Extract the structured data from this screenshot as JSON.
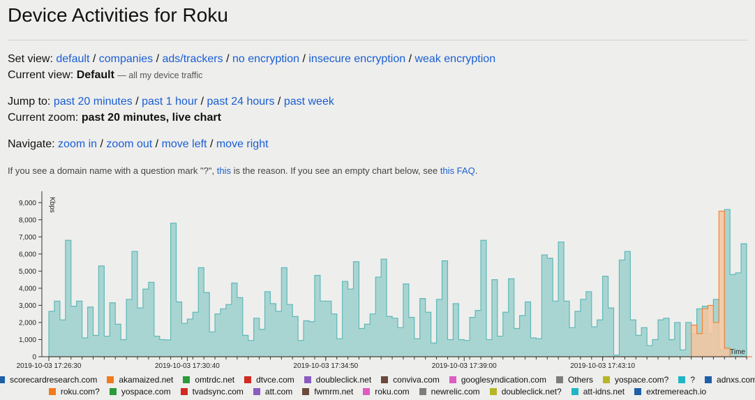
{
  "page": {
    "title": "Device Activities for Roku"
  },
  "views": {
    "label": "Set view:",
    "links": [
      "default",
      "companies",
      "ads/trackers",
      "no encryption",
      "insecure encryption",
      "weak encryption"
    ],
    "current_label": "Current view:",
    "current_value": "Default",
    "current_note": "— all my device traffic"
  },
  "jump": {
    "label": "Jump to:",
    "links": [
      "past 20 minutes",
      "past 1 hour",
      "past 24 hours",
      "past week"
    ],
    "current_label": "Current zoom:",
    "current_value": "past 20 minutes, live chart"
  },
  "navigate": {
    "label": "Navigate:",
    "links": [
      "zoom in",
      "zoom out",
      "move left",
      "move right"
    ]
  },
  "note": {
    "part1": "If you see a domain name with a question mark \"?\", ",
    "link1": "this",
    "part2": " is the reason. If you see an empty chart below, see ",
    "link2": "this FAQ",
    "part3": "."
  },
  "chart_data": {
    "type": "area",
    "ylabel": "Kbps",
    "xlabel": "Time",
    "ylim": [
      0,
      9500
    ],
    "yticks": [
      "0",
      "1,000",
      "2,000",
      "3,000",
      "4,000",
      "5,000",
      "6,000",
      "7,000",
      "8,000",
      "9,000"
    ],
    "xticks": [
      "2019-10-03 17:26:30",
      "2019-10-03 17:30:40",
      "2019-10-03 17:34:50",
      "2019-10-03 17:39:00",
      "2019-10-03 17:43:10"
    ],
    "grid": false,
    "series": [
      {
        "name": "yospace.com?",
        "color": "#a8d5d2",
        "stroke": "#5fb8b8",
        "values": [
          2650,
          3250,
          2150,
          6800,
          2950,
          3250,
          1100,
          2900,
          1250,
          5300,
          1200,
          3150,
          1900,
          1000,
          3350,
          6150,
          2850,
          3950,
          4350,
          1200,
          1000,
          980,
          7800,
          3200,
          1950,
          2200,
          2600,
          5200,
          3750,
          1450,
          2500,
          2800,
          3050,
          4300,
          3450,
          1250,
          950,
          2250,
          1600,
          3800,
          3100,
          2650,
          5200,
          3050,
          2350,
          950,
          2100,
          2050,
          4750,
          3250,
          3250,
          2500,
          1050,
          4400,
          3950,
          5550,
          1650,
          1900,
          2500,
          4650,
          5700,
          2350,
          2250,
          1700,
          4250,
          2300,
          1050,
          3400,
          2600,
          800,
          3350,
          5600,
          1000,
          3100,
          1000,
          950,
          2300,
          2700,
          6800,
          1000,
          4500,
          1200,
          2600,
          4550,
          1650,
          2400,
          3200,
          1100,
          1050,
          5950,
          5750,
          3250,
          6700,
          3250,
          1700,
          2650,
          3350,
          3800,
          1750,
          2150,
          4700,
          2850,
          100,
          5650,
          6150,
          2150,
          1250,
          1700,
          650,
          1000,
          2150,
          2250,
          1000,
          2000,
          400,
          2000,
          1350,
          2800,
          2950,
          1350,
          3350,
          400,
          8600,
          4800,
          4900,
          6600
        ]
      },
      {
        "name": "roku.com?",
        "color": "#f5c6a0",
        "stroke": "#f2833a",
        "values": [
          0,
          0,
          0,
          0,
          0,
          0,
          0,
          0,
          0,
          0,
          0,
          0,
          0,
          0,
          0,
          0,
          0,
          0,
          0,
          0,
          0,
          0,
          0,
          0,
          0,
          0,
          0,
          0,
          0,
          0,
          0,
          0,
          0,
          0,
          0,
          0,
          0,
          0,
          0,
          0,
          0,
          0,
          0,
          0,
          0,
          0,
          0,
          0,
          0,
          0,
          0,
          0,
          0,
          0,
          0,
          0,
          0,
          0,
          0,
          0,
          0,
          0,
          0,
          0,
          0,
          0,
          0,
          0,
          0,
          0,
          0,
          0,
          0,
          0,
          0,
          0,
          0,
          0,
          0,
          0,
          0,
          0,
          0,
          0,
          0,
          0,
          0,
          0,
          0,
          0,
          0,
          0,
          0,
          0,
          0,
          0,
          0,
          0,
          0,
          0,
          0,
          0,
          0,
          0,
          0,
          0,
          0,
          0,
          0,
          0,
          0,
          0,
          0,
          0,
          0,
          0,
          1850,
          1350,
          2800,
          3000,
          2000,
          8500,
          500,
          0,
          0,
          0,
          0
        ]
      }
    ],
    "legend": [
      [
        {
          "name": "scorecardresearch.com",
          "color": "#1f5fa8"
        },
        {
          "name": "akamaized.net",
          "color": "#f27a1e"
        },
        {
          "name": "omtrdc.net",
          "color": "#2a9a3a"
        },
        {
          "name": "dtvce.com",
          "color": "#d12a22"
        },
        {
          "name": "doubleclick.net",
          "color": "#8a5bc0"
        },
        {
          "name": "conviva.com",
          "color": "#6b4a3e"
        },
        {
          "name": "googlesyndication.com",
          "color": "#de5bc1"
        },
        {
          "name": "Others",
          "color": "#7d7d7d"
        },
        {
          "name": "yospace.com?",
          "color": "#b6b628"
        },
        {
          "name": "?",
          "color": "#1fb5c5"
        },
        {
          "name": "adnxs.com",
          "color": "#1f5fa8"
        }
      ],
      [
        {
          "name": "roku.com?",
          "color": "#f27a1e"
        },
        {
          "name": "yospace.com",
          "color": "#2a9a3a"
        },
        {
          "name": "tvadsync.com",
          "color": "#d12a22"
        },
        {
          "name": "att.com",
          "color": "#8a5bc0"
        },
        {
          "name": "fwmrm.net",
          "color": "#6b4a3e"
        },
        {
          "name": "roku.com",
          "color": "#de5bc1"
        },
        {
          "name": "newrelic.com",
          "color": "#7d7d7d"
        },
        {
          "name": "doubleclick.net?",
          "color": "#b6b628"
        },
        {
          "name": "att-idns.net",
          "color": "#1fb5c5"
        },
        {
          "name": "extremereach.io",
          "color": "#1f5fa8"
        }
      ]
    ]
  }
}
